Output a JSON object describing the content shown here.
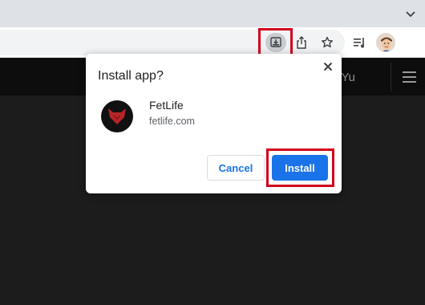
{
  "browser": {
    "tabstrip_icon": "chevron-down-icon",
    "toolbar_icons": [
      "install-app-icon",
      "share-icon",
      "bookmark-star-icon",
      "reading-list-icon",
      "profile-avatar"
    ]
  },
  "site": {
    "username_partial": "terYu",
    "menu_icon": "hamburger-menu-icon"
  },
  "dialog": {
    "title": "Install app?",
    "app_name": "FetLife",
    "app_host": "fetlife.com",
    "cancel_label": "Cancel",
    "install_label": "Install"
  },
  "colors": {
    "primary_blue": "#1a73e8",
    "highlight_red": "#d0021b",
    "site_background": "#1c1c1c",
    "app_icon_red": "#c0392b"
  }
}
